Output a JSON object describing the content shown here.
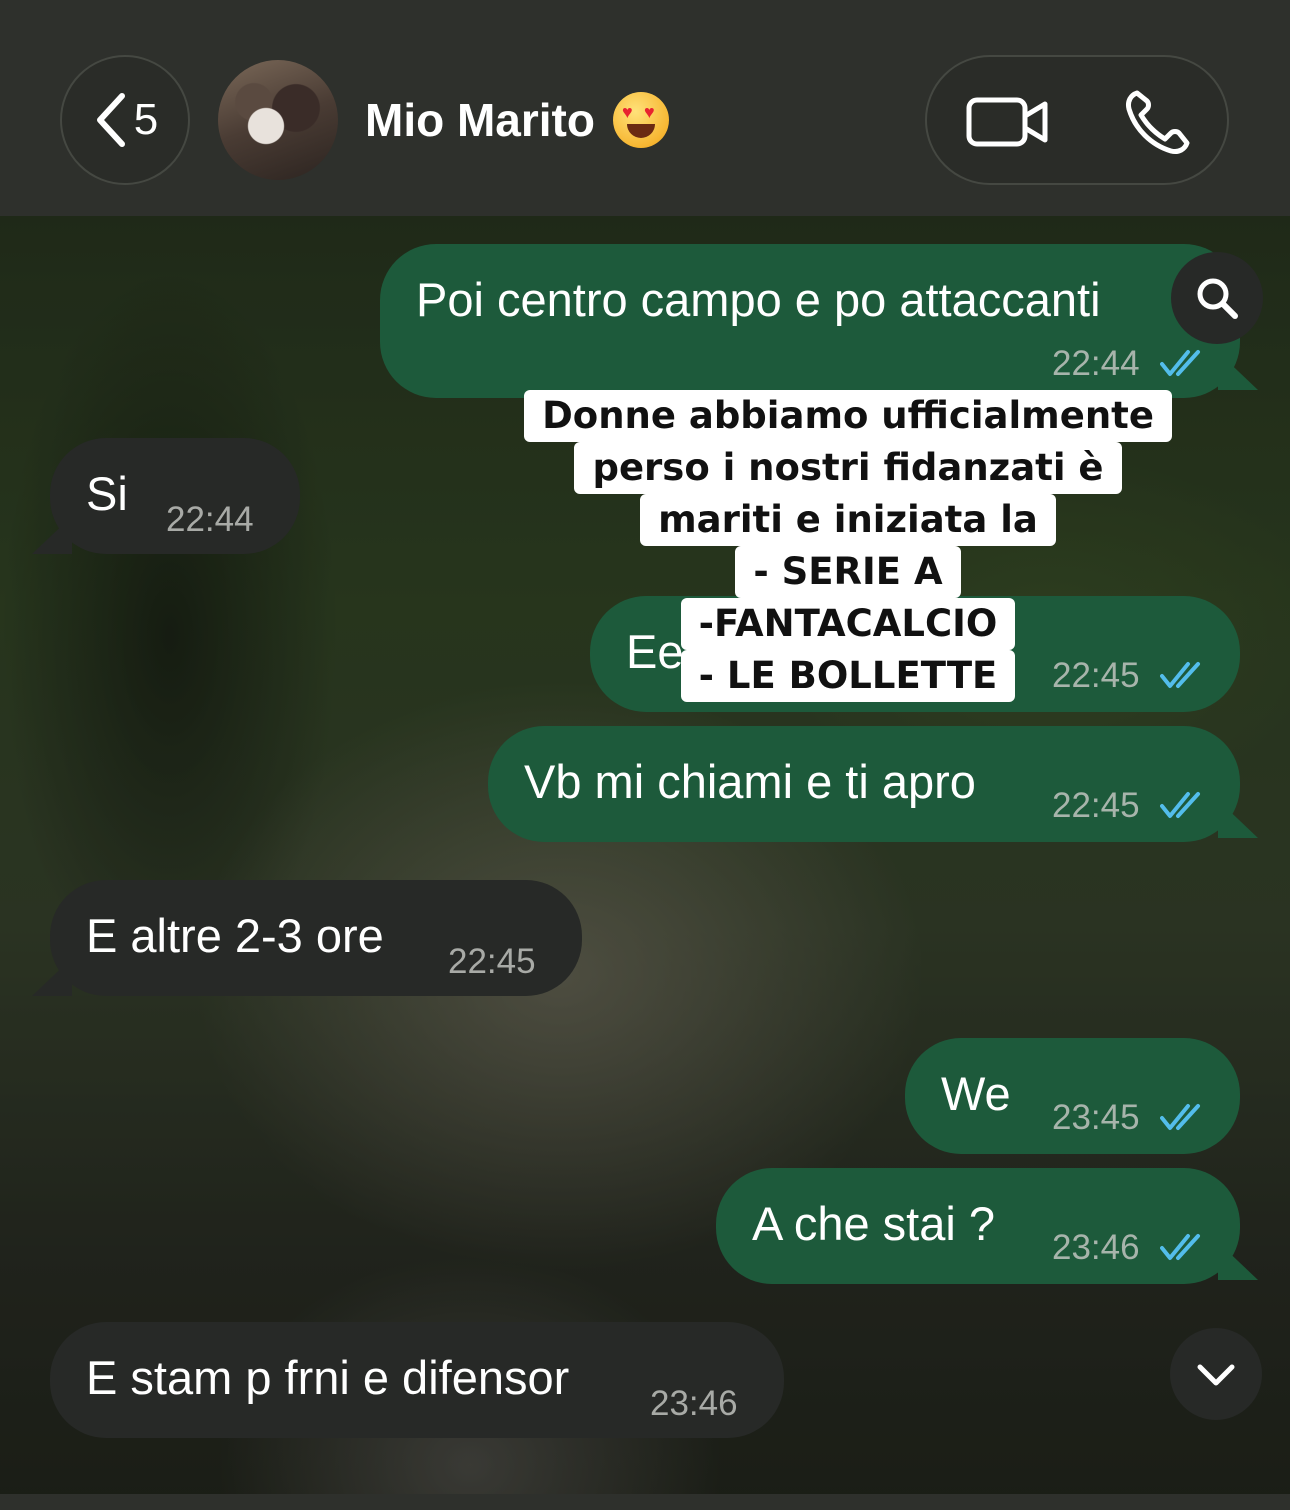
{
  "header": {
    "back_count": "5",
    "contact_name": "Mio Marito",
    "contact_emoji": "heart-eyes-emoji",
    "video_icon": "video-camera-icon",
    "call_icon": "phone-icon"
  },
  "messages": [
    {
      "direction": "out",
      "text": "Poi centro campo e po attaccanti",
      "time": "22:44",
      "read": true
    },
    {
      "direction": "in",
      "text": "Si",
      "time": "22:44"
    },
    {
      "direction": "out",
      "text": "Ee",
      "time": "22:45",
      "read": true
    },
    {
      "direction": "out",
      "text": "Vb mi chiami e ti apro",
      "time": "22:45",
      "read": true
    },
    {
      "direction": "in",
      "text": "E altre 2-3 ore",
      "time": "22:45"
    },
    {
      "direction": "out",
      "text": "We",
      "time": "23:45",
      "read": true
    },
    {
      "direction": "out",
      "text": "A che stai ?",
      "time": "23:46",
      "read": true
    },
    {
      "direction": "in",
      "text": "E stam p frni e difensor",
      "time": "23:46"
    }
  ],
  "caption": {
    "lines": [
      "Donne abbiamo ufficialmente",
      "perso i nostri fidanzati è",
      "mariti e iniziata la",
      "- SERIE A",
      "-FANTACALCIO",
      "- LE BOLLETTE"
    ]
  },
  "colors": {
    "header_bg": "#2e302c",
    "outgoing_bubble": "#1d5a3b",
    "incoming_bubble": "#272927",
    "read_ticks": "#53bdeb",
    "timestamp": "#a7b4ab"
  },
  "icons": {
    "back": "chevron-left-icon",
    "search": "search-icon",
    "scroll_down": "chevron-down-icon",
    "read_receipt": "double-check-icon"
  }
}
